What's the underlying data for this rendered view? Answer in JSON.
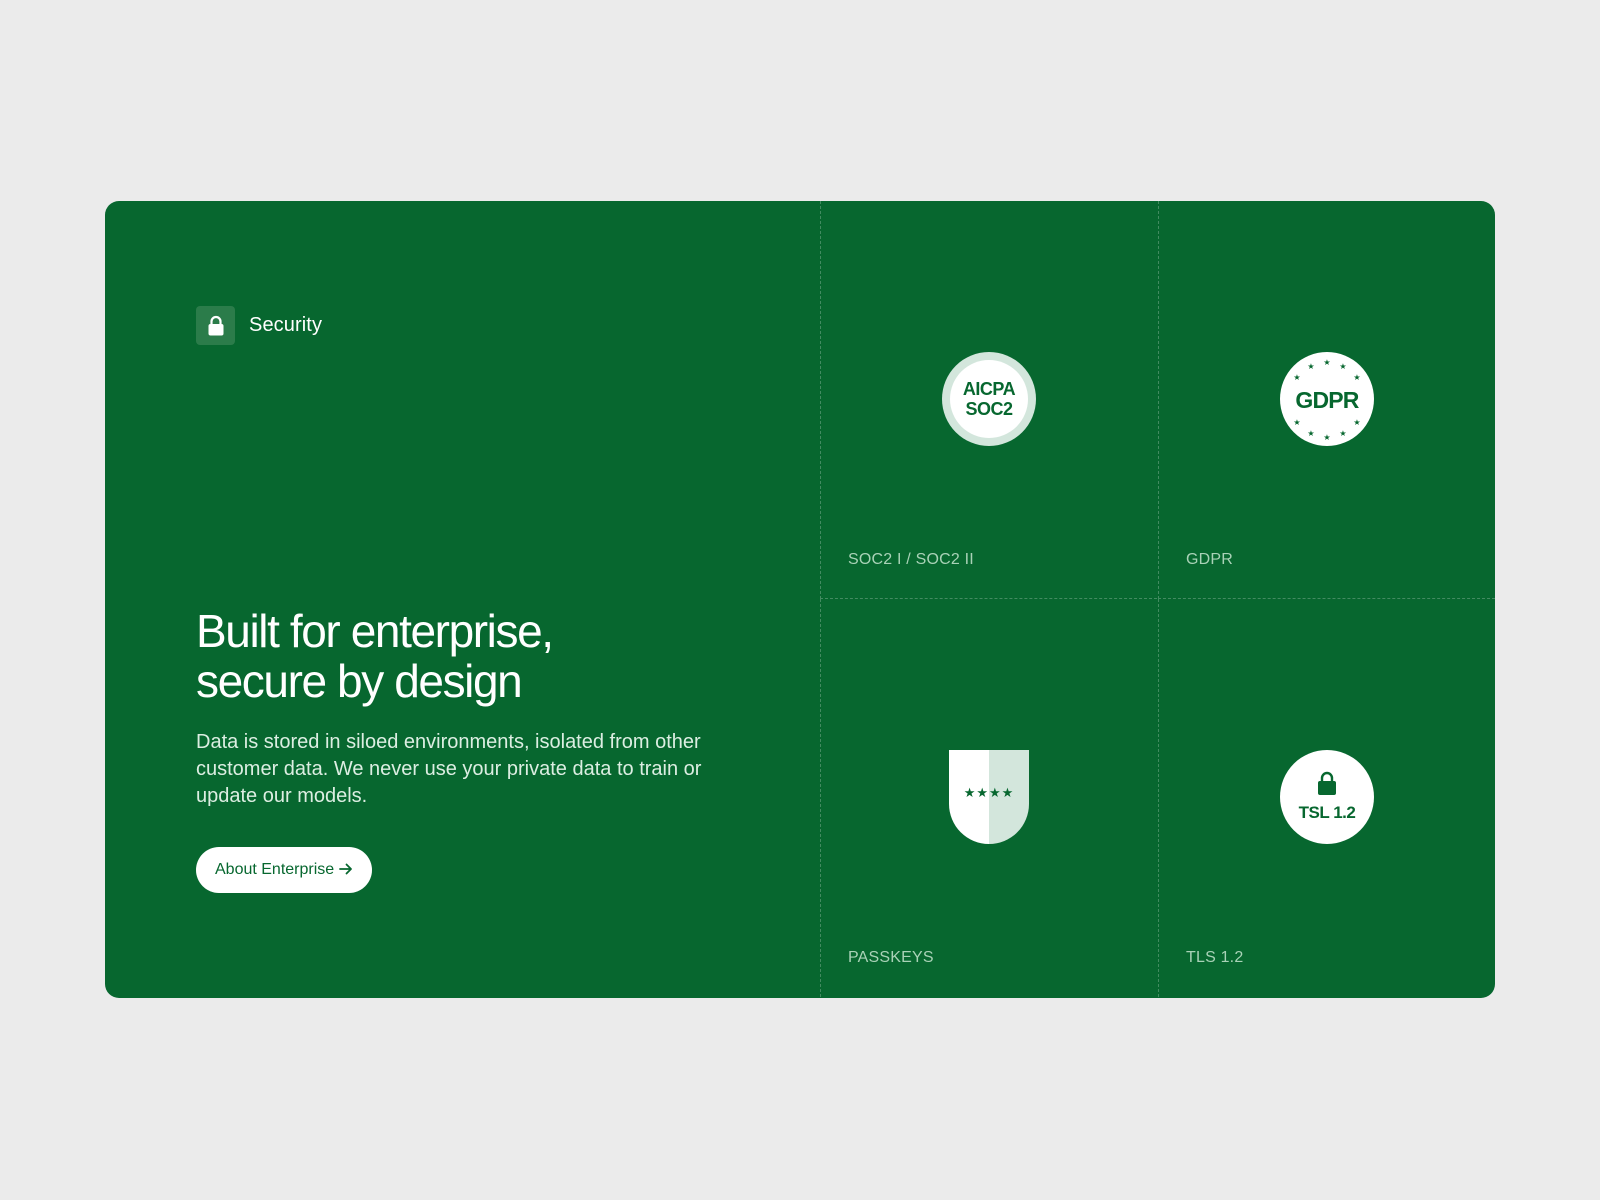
{
  "header": {
    "eyebrow_label": "Security",
    "eyebrow_icon": "lock-icon"
  },
  "hero": {
    "headline_line1": "Built for enterprise,",
    "headline_line2": "secure by design",
    "body": "Data is stored in siloed environments, isolated from other customer data. We never use your private data to train or update our models.",
    "cta_label": "About Enterprise",
    "cta_icon": "arrow-right-icon"
  },
  "colors": {
    "page_bg": "#ebebeb",
    "card_bg": "#07672f",
    "accent_light": "#d3e6dc",
    "label_text": "#a9d2b7"
  },
  "certifications": [
    {
      "label": "SOC2 I / SOC2 II",
      "badge_line1": "AICPA",
      "badge_line2": "SOC2",
      "icon": "aicpa-soc2-seal-icon"
    },
    {
      "label": "GDPR",
      "badge_text": "GDPR",
      "icon": "gdpr-stars-seal-icon"
    },
    {
      "label": "PASSKEYS",
      "badge_text": "★★★★",
      "icon": "passkeys-shield-icon"
    },
    {
      "label": "TLS 1.2",
      "badge_text": "TSL 1.2",
      "icon": "tls-lock-badge-icon"
    }
  ]
}
